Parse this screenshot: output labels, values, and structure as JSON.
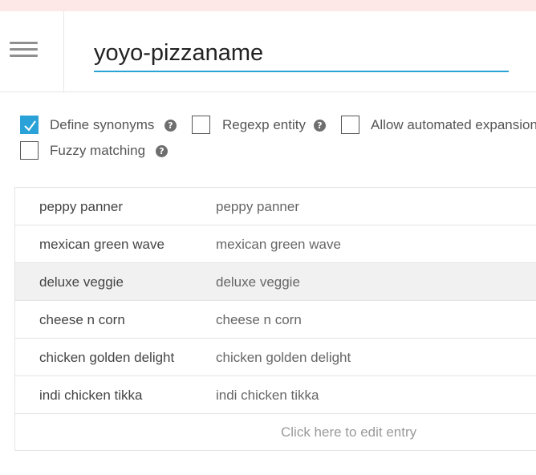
{
  "entity": {
    "name": "yoyo-pizzaname"
  },
  "options": {
    "define_synonyms": {
      "label": "Define synonyms",
      "checked": true
    },
    "regexp_entity": {
      "label": "Regexp entity",
      "checked": false
    },
    "allow_automated_expansion": {
      "label": "Allow automated expansion",
      "checked": false
    },
    "fuzzy_matching": {
      "label": "Fuzzy matching",
      "checked": false
    },
    "help_glyph": "?"
  },
  "entries": [
    {
      "value": "peppy panner",
      "synonyms": "peppy panner"
    },
    {
      "value": "mexican green wave",
      "synonyms": "mexican green wave"
    },
    {
      "value": "deluxe veggie",
      "synonyms": "deluxe veggie"
    },
    {
      "value": "cheese n corn",
      "synonyms": "cheese n corn"
    },
    {
      "value": "chicken golden delight",
      "synonyms": "chicken golden delight"
    },
    {
      "value": "indi chicken tikka",
      "synonyms": "indi chicken tikka"
    }
  ],
  "edit_entry_label": "Click here to edit entry",
  "colors": {
    "accent": "#2aa2d8",
    "top_strip": "#fde7e7",
    "row_hover": "#f1f1f1"
  },
  "icons": {
    "menu": "hamburger-menu-icon",
    "help": "question-circle-icon",
    "check": "checkmark-icon"
  }
}
